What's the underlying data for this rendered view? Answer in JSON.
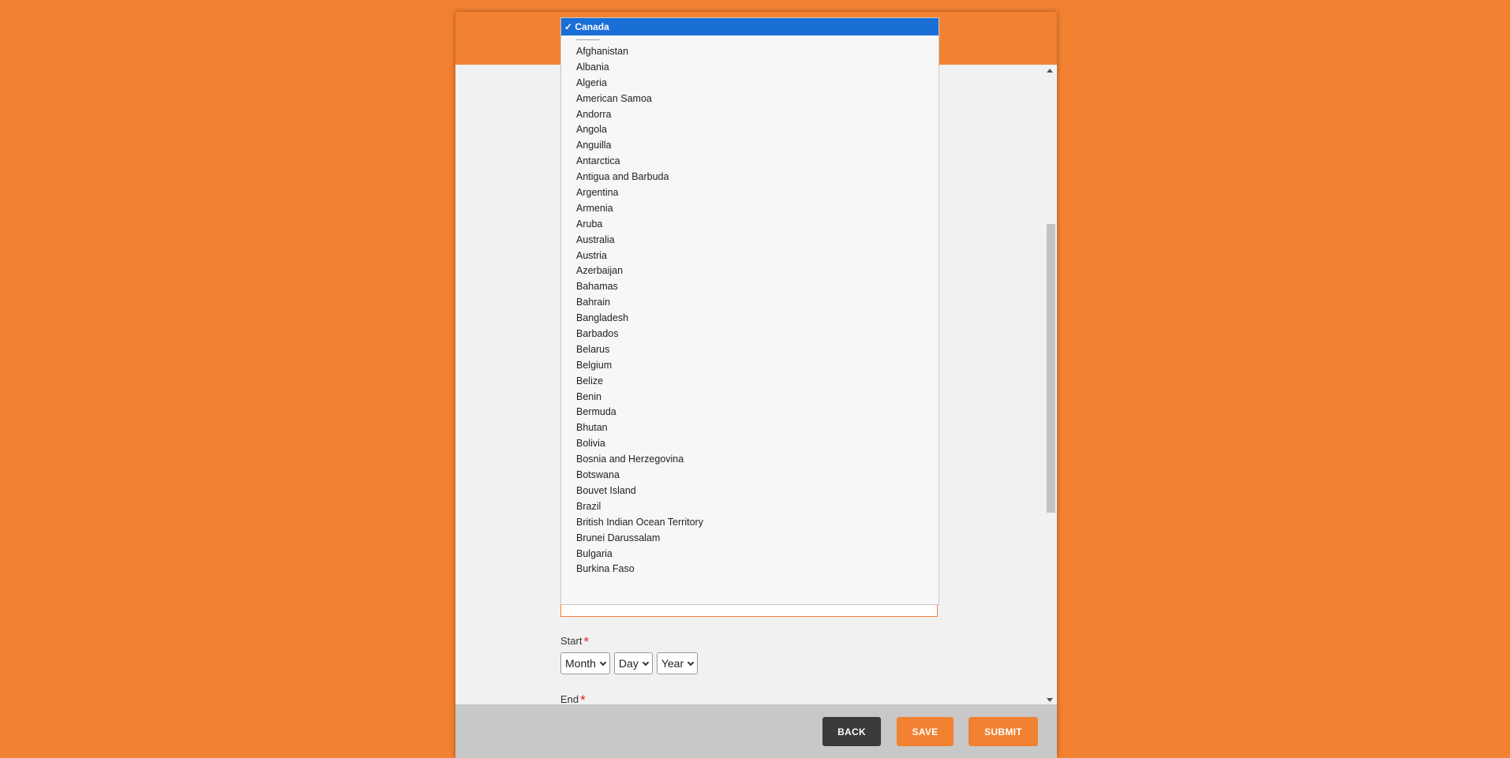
{
  "country_field": {
    "selected_value": "Canada",
    "dropdown": {
      "selected_label": "✓ Canada",
      "separator": "----------",
      "options": [
        "Afghanistan",
        "Albania",
        "Algeria",
        "American Samoa",
        "Andorra",
        "Angola",
        "Anguilla",
        "Antarctica",
        "Antigua and Barbuda",
        "Argentina",
        "Armenia",
        "Aruba",
        "Australia",
        "Austria",
        "Azerbaijan",
        "Bahamas",
        "Bahrain",
        "Bangladesh",
        "Barbados",
        "Belarus",
        "Belgium",
        "Belize",
        "Benin",
        "Bermuda",
        "Bhutan",
        "Bolivia",
        "Bosnia and Herzegovina",
        "Botswana",
        "Bouvet Island",
        "Brazil",
        "British Indian Ocean Territory",
        "Brunei Darussalam",
        "Bulgaria",
        "Burkina Faso"
      ]
    }
  },
  "start_field": {
    "label": "Start",
    "required_mark": "*",
    "month": "Month",
    "day": "Day",
    "year": "Year"
  },
  "end_field": {
    "label": "End",
    "required_mark": "*"
  },
  "footer": {
    "back_label": "BACK",
    "save_label": "SAVE",
    "submit_label": "SUBMIT"
  },
  "colors": {
    "brand_orange": "#f28131",
    "selected_blue": "#1a6fd6",
    "back_button": "#3a3a3a",
    "required_red": "#e21f1f"
  }
}
